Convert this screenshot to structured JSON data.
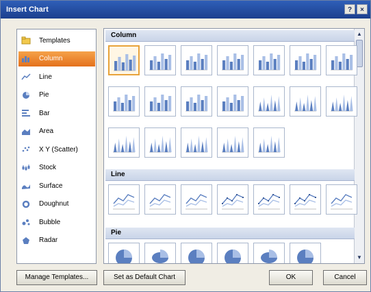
{
  "window": {
    "title": "Insert Chart",
    "help_glyph": "?",
    "close_glyph": "×"
  },
  "sidebar": {
    "items": [
      {
        "label": "Templates",
        "icon": "folder-icon",
        "selected": false
      },
      {
        "label": "Column",
        "icon": "column-chart-icon",
        "selected": true
      },
      {
        "label": "Line",
        "icon": "line-chart-icon",
        "selected": false
      },
      {
        "label": "Pie",
        "icon": "pie-chart-icon",
        "selected": false
      },
      {
        "label": "Bar",
        "icon": "bar-chart-icon",
        "selected": false
      },
      {
        "label": "Area",
        "icon": "area-chart-icon",
        "selected": false
      },
      {
        "label": "X Y (Scatter)",
        "icon": "scatter-chart-icon",
        "selected": false
      },
      {
        "label": "Stock",
        "icon": "stock-chart-icon",
        "selected": false
      },
      {
        "label": "Surface",
        "icon": "surface-chart-icon",
        "selected": false
      },
      {
        "label": "Doughnut",
        "icon": "doughnut-chart-icon",
        "selected": false
      },
      {
        "label": "Bubble",
        "icon": "bubble-chart-icon",
        "selected": false
      },
      {
        "label": "Radar",
        "icon": "radar-chart-icon",
        "selected": false
      }
    ]
  },
  "gallery": {
    "sections": [
      {
        "title": "Column",
        "thumbnails": [
          "clustered-column",
          "stacked-column",
          "100-stacked-column",
          "3d-clustered-column",
          "3d-stacked-column",
          "3d-100-stacked-column",
          "3d-column",
          "clustered-cylinder",
          "stacked-cylinder",
          "100-stacked-cylinder",
          "3d-cylinder",
          "clustered-cone",
          "stacked-cone",
          "100-stacked-cone",
          "3d-cone",
          "clustered-pyramid",
          "stacked-pyramid",
          "100-stacked-pyramid",
          "3d-pyramid"
        ]
      },
      {
        "title": "Line",
        "thumbnails": [
          "line",
          "stacked-line",
          "100-stacked-line",
          "line-with-markers",
          "stacked-line-with-markers",
          "100-stacked-line-with-markers",
          "3d-line"
        ]
      },
      {
        "title": "Pie",
        "thumbnails": [
          "pie",
          "3d-pie",
          "pie-of-pie",
          "exploded-pie",
          "3d-exploded-pie",
          "bar-of-pie"
        ]
      }
    ]
  },
  "buttons": {
    "manage_templates": "Manage Templates...",
    "set_default": "Set as Default Chart",
    "ok": "OK",
    "cancel": "Cancel"
  },
  "colors": {
    "accent": "#e4711c",
    "chart_blue": "#5b7fc0",
    "title_bar": "#1b3f8e"
  }
}
